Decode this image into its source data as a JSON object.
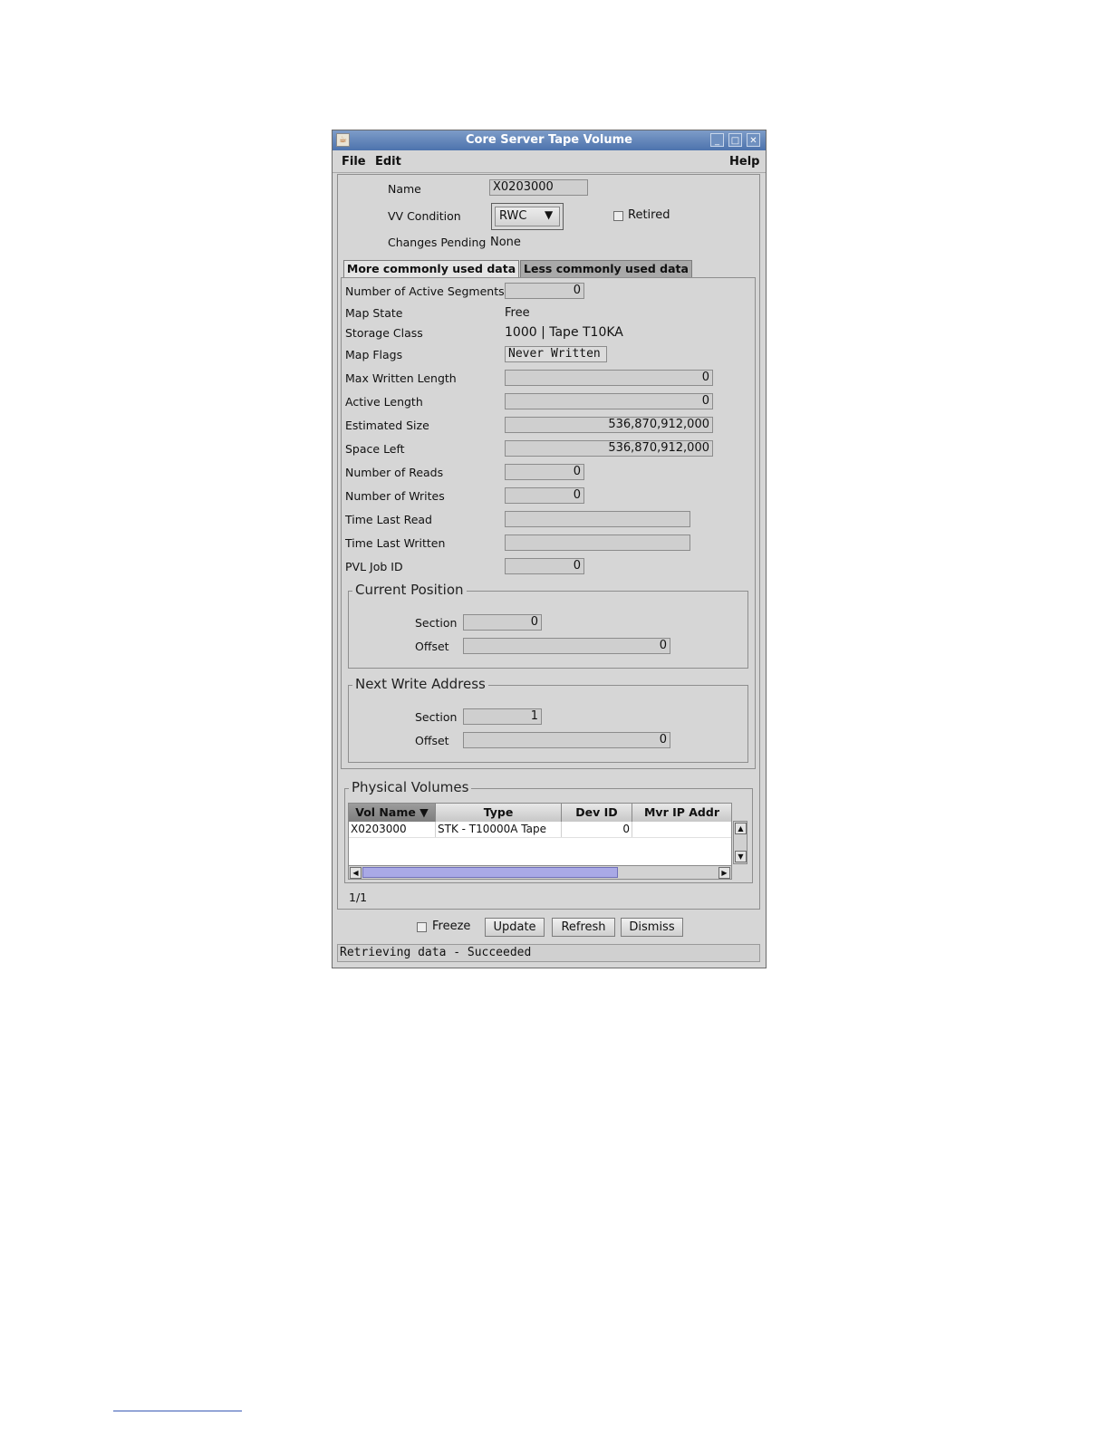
{
  "window": {
    "title": "Core Server Tape Volume"
  },
  "menubar": {
    "file": "File",
    "edit": "Edit",
    "help": "Help"
  },
  "header": {
    "name_label": "Name",
    "name_value": "X0203000",
    "vv_condition_label": "VV Condition",
    "vv_condition_value": "RWC",
    "retired_label": "Retired",
    "retired_checked": false,
    "changes_pending_label": "Changes Pending",
    "changes_pending_value": "None"
  },
  "tabs": [
    {
      "label": "More commonly used data",
      "active": true
    },
    {
      "label": "Less commonly used data",
      "active": false
    }
  ],
  "fields": {
    "active_segments": {
      "label": "Number of Active Segments",
      "value": "0"
    },
    "map_state": {
      "label": "Map State",
      "value": "Free"
    },
    "storage_class": {
      "label": "Storage Class",
      "value": "1000 | Tape T10KA"
    },
    "map_flags": {
      "label": "Map Flags",
      "value": "Never Written"
    },
    "max_written_length": {
      "label": "Max Written Length",
      "value": "0"
    },
    "active_length": {
      "label": "Active Length",
      "value": "0"
    },
    "estimated_size": {
      "label": "Estimated Size",
      "value": "536,870,912,000"
    },
    "space_left": {
      "label": "Space Left",
      "value": "536,870,912,000"
    },
    "number_of_reads": {
      "label": "Number of Reads",
      "value": "0"
    },
    "number_of_writes": {
      "label": "Number of Writes",
      "value": "0"
    },
    "time_last_read": {
      "label": "Time Last Read",
      "value": ""
    },
    "time_last_written": {
      "label": "Time Last Written",
      "value": ""
    },
    "pvl_job_id": {
      "label": "PVL Job ID",
      "value": "0"
    }
  },
  "current_position": {
    "title": "Current Position",
    "section_label": "Section",
    "section_value": "0",
    "offset_label": "Offset",
    "offset_value": "0"
  },
  "next_write_address": {
    "title": "Next Write Address",
    "section_label": "Section",
    "section_value": "1",
    "offset_label": "Offset",
    "offset_value": "0"
  },
  "physical_volumes": {
    "title": "Physical Volumes",
    "columns": [
      "Vol Name ▼",
      "Type",
      "Dev ID",
      "Mvr IP Addr"
    ],
    "rows": [
      {
        "vol_name": "X0203000",
        "type": "STK - T10000A Tape",
        "dev_id": "0",
        "mvr_ip_addr": ""
      }
    ],
    "count": "1/1",
    "hscroll_fraction": 0.72
  },
  "footer": {
    "freeze_label": "Freeze",
    "freeze_checked": false,
    "update_label": "Update",
    "refresh_label": "Refresh",
    "dismiss_label": "Dismiss",
    "status": "Retrieving data - Succeeded"
  },
  "colors": {
    "titlebar": "#4d73ad",
    "window_bg": "#d6d6d6",
    "scroll_thumb": "#a9a9e6"
  }
}
